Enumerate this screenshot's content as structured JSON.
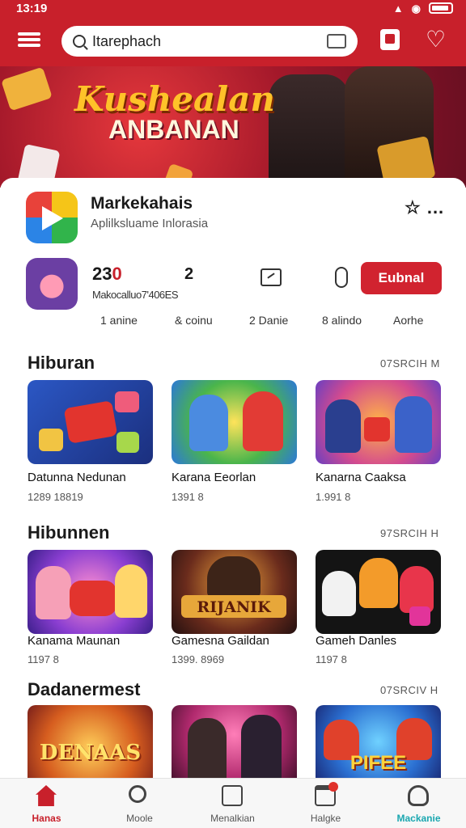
{
  "status": {
    "time": "13:19",
    "icons": [
      "wifi-icon",
      "signal-icon",
      "battery-icon"
    ]
  },
  "header": {
    "search_text": "Itarephach",
    "menu_icon": "menu-icon",
    "camera_icon": "camera-icon",
    "bag_icon": "bag-icon",
    "heart_icon": "heart-icon"
  },
  "banner": {
    "title": "Kushealan",
    "subtitle": "ANBANAN"
  },
  "app": {
    "name": "Markekahais",
    "subtitle": "Aplilksluame Inlorasia",
    "more": "☆ ...",
    "rating_main": "23",
    "rating_accent": "0",
    "downloads": "Makocalluo7'406ES",
    "stat2": "2",
    "install_label": "Eubnal"
  },
  "meta": [
    "1 anine",
    "& coinu",
    "2 Danie",
    "8 alindo",
    "Aorhe"
  ],
  "sections": [
    {
      "title": "Hiburan",
      "more": "07SRCIH M",
      "items": [
        {
          "title": "Datunna Nedunan",
          "sub": "1289 18819"
        },
        {
          "title": "Karana Eeorlan",
          "sub": "1391 8"
        },
        {
          "title": "Kanarna Caaksa",
          "sub": "1.991 8"
        }
      ]
    },
    {
      "title": "Hibunnen",
      "more": "97SRCIH H",
      "items": [
        {
          "title": "Kanama Maunan",
          "sub": "1197 8"
        },
        {
          "title": "Gamesna Gaildan",
          "sub": "1399. 8969"
        },
        {
          "title": "Gameh Danles",
          "sub": "1197 8"
        }
      ]
    },
    {
      "title": "Dadanermest",
      "more": "07SRCIV H",
      "items": [
        {
          "title": "DENAAS"
        },
        {
          "title": ""
        },
        {
          "title": "PIFEE"
        }
      ]
    }
  ],
  "tile_art": [
    "RIJANIK"
  ],
  "nav": [
    {
      "label": "Hanas",
      "icon": "home-icon",
      "color": "#c8202b"
    },
    {
      "label": "Moole",
      "icon": "search-icon",
      "color": "#555555"
    },
    {
      "label": "Menalkian",
      "icon": "box-icon",
      "color": "#555555"
    },
    {
      "label": "Halgke",
      "icon": "cart-icon",
      "color": "#555555"
    },
    {
      "label": "Mackanie",
      "icon": "user-icon",
      "color": "#1aa7b0"
    }
  ]
}
